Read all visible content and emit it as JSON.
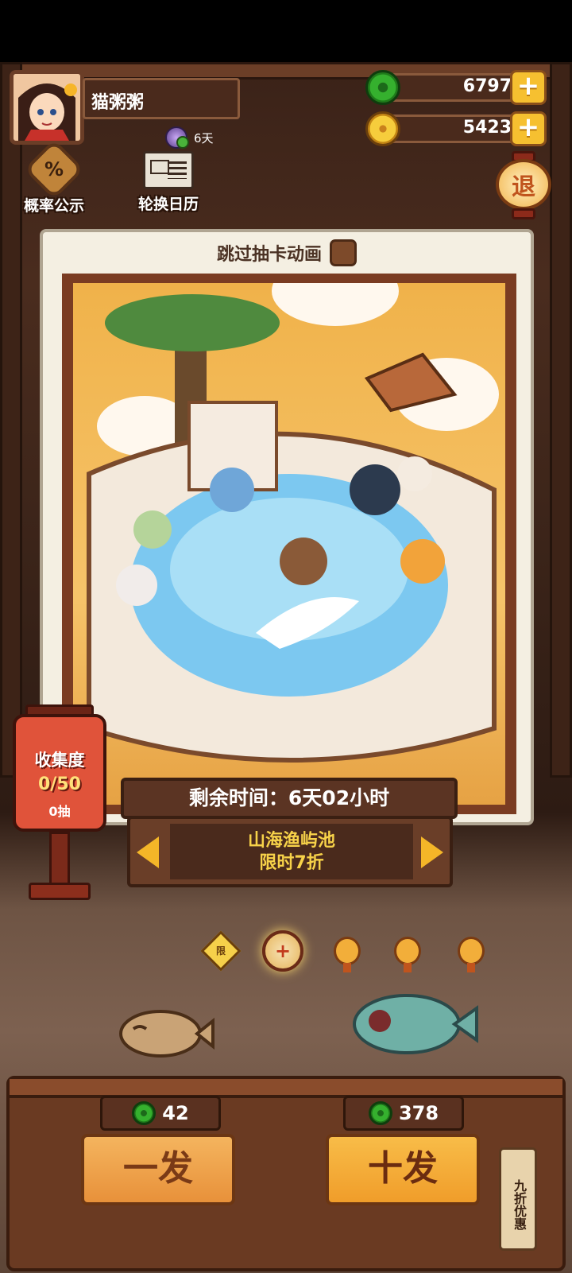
{
  "player": {
    "name": "猫粥粥",
    "days": "6天"
  },
  "currency": {
    "jade": "6797",
    "gold": "5423",
    "plus": "+"
  },
  "buttons": {
    "rates": "概率公示",
    "rates_icon": "%",
    "calendar": "轮换日历",
    "exit": "退"
  },
  "pool": {
    "skip_label": "跳过抽卡动画",
    "timer": "剩余时间：6天02小时",
    "name_line1": "山海渔屿池",
    "name_line2": "限时7折"
  },
  "collection": {
    "title": "收集度",
    "progress": "0/50",
    "draws": "0抽"
  },
  "pages": {
    "limited_label": "限",
    "active_icon": "+",
    "count": 5,
    "active_index": 1
  },
  "draw": {
    "single_label": "一发",
    "single_price": "42",
    "ten_label": "十发",
    "ten_price": "378",
    "discount_tag": "九折优惠"
  },
  "colors": {
    "accent": "#f4b628",
    "jade": "#35b02e",
    "gold": "#f6cd3c",
    "panel": "#4a2a1c"
  }
}
